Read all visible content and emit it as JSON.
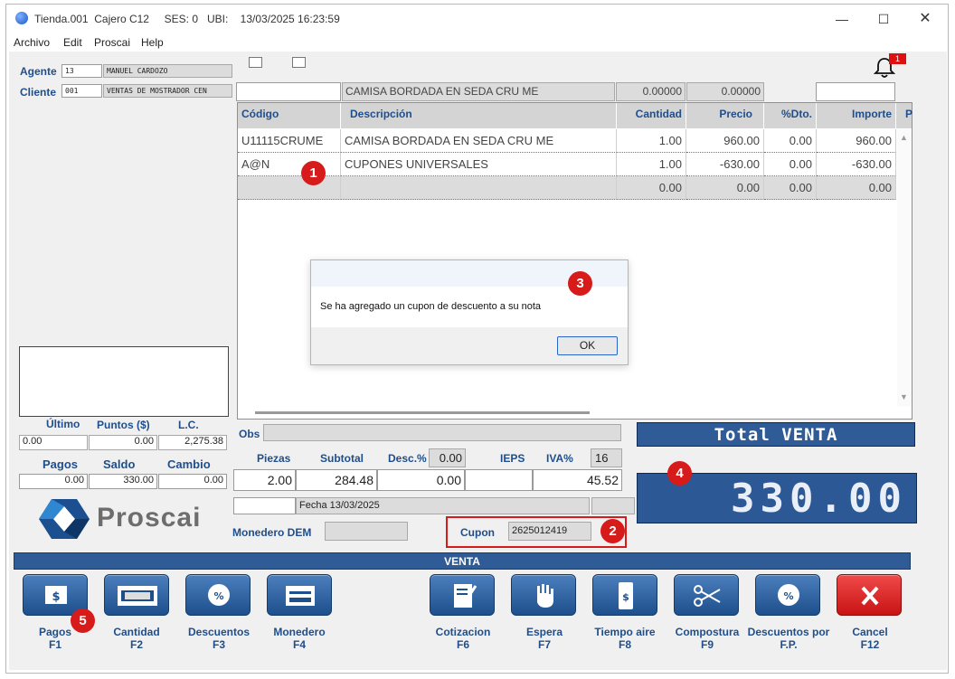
{
  "window": {
    "title": "Tienda.001  Cajero C12     SES: 0   UBI:    13/03/2025 16:23:59"
  },
  "menu": [
    "Archivo",
    "Edit",
    "Proscai",
    "Help"
  ],
  "agent": {
    "label": "Agente",
    "code": "13",
    "name": "MANUEL CARDOZO"
  },
  "client": {
    "label": "Cliente",
    "code": "001",
    "name": "VENTAS DE MOSTRADOR CEN"
  },
  "notification_count": "1",
  "item_entry": {
    "code": "",
    "description": "CAMISA BORDADA EN SEDA CRU ME",
    "qty": "0.00000",
    "price": "0.00000",
    "extra": ""
  },
  "grid": {
    "headers": [
      "Código",
      "Descripción",
      "Cantidad",
      "Precio",
      "%Dto.",
      "Importe",
      "P"
    ],
    "rows": [
      [
        "U11115CRUME",
        "CAMISA BORDADA EN SEDA CRU ME",
        "1.00",
        "960.00",
        "0.00",
        "960.00"
      ],
      [
        "A@N",
        "CUPONES UNIVERSALES",
        "1.00",
        "-630.00",
        "0.00",
        "-630.00"
      ],
      [
        "",
        "",
        "0.00",
        "0.00",
        "0.00",
        "0.00"
      ]
    ]
  },
  "dialog": {
    "message": "Se ha agregado un cupon de descuento a su nota",
    "ok": "OK"
  },
  "balances": {
    "labels": [
      "Último",
      "Puntos ($)",
      "L.C."
    ],
    "values": [
      "0.00",
      "0.00",
      "2,275.38"
    ],
    "labels2": [
      "Pagos",
      "Saldo",
      "Cambio"
    ],
    "values2": [
      "0.00",
      "330.00",
      "0.00"
    ]
  },
  "brand": {
    "name": "Proscai"
  },
  "obs": {
    "label": "Obs",
    "value": ""
  },
  "totals": {
    "labels": [
      "Piezas",
      "Subtotal",
      "Desc.%",
      "IEPS",
      "IVA%"
    ],
    "desc_pct": "0.00",
    "iva_pct": "16",
    "piezas": "2.00",
    "subtotal": "284.48",
    "desc": "0.00",
    "ieps": "",
    "iva": "45.52"
  },
  "fecha": "Fecha 13/03/2025",
  "monedero": {
    "label": "Monedero DEM",
    "value": ""
  },
  "cupon": {
    "label": "Cupon",
    "value": "2625012419"
  },
  "total_venta": {
    "label": "Total VENTA",
    "value": "330.00"
  },
  "section_title": "VENTA",
  "function_buttons": [
    {
      "label": "Pagos",
      "key": "F1",
      "icon": "cash-icon"
    },
    {
      "label": "Cantidad",
      "key": "F2",
      "icon": "calculator-icon"
    },
    {
      "label": "Descuentos",
      "key": "F3",
      "icon": "percent-icon"
    },
    {
      "label": "Monedero",
      "key": "F4",
      "icon": "wallet-card-icon"
    },
    {
      "label": "Cotizacion",
      "key": "F6",
      "icon": "quote-edit-icon"
    },
    {
      "label": "Espera",
      "key": "F7",
      "icon": "hand-icon"
    },
    {
      "label": "Tiempo aire",
      "key": "F8",
      "icon": "phone-credit-icon"
    },
    {
      "label": "Compostura",
      "key": "F9",
      "icon": "scissors-icon"
    },
    {
      "label": "Descuentos por",
      "key": "F.P.",
      "icon": "percent-icon"
    },
    {
      "label": "Cancel",
      "key": "F12",
      "icon": "cancel-icon"
    }
  ],
  "annotations": [
    "1",
    "2",
    "3",
    "4",
    "5"
  ]
}
